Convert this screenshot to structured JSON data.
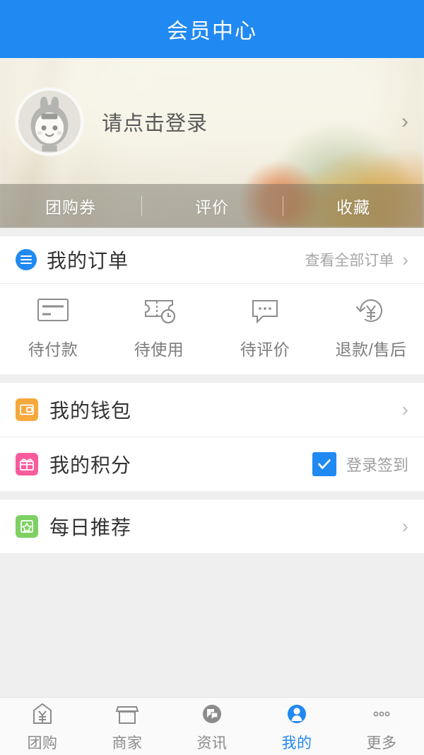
{
  "header": {
    "title": "会员中心",
    "bg_color": "#2089f2"
  },
  "profile": {
    "login_text": "请点击登录",
    "avatar_icon": "default-rabbit-avatar",
    "arrow_icon": "chevron-right-icon"
  },
  "stats": [
    {
      "label": "团购券"
    },
    {
      "label": "评价"
    },
    {
      "label": "收藏"
    }
  ],
  "orders": {
    "title": "我的订单",
    "icon": "list-circle-icon",
    "view_all": "查看全部订单",
    "chevron_icon": "chevron-right-icon",
    "items": [
      {
        "label": "待付款",
        "icon": "credit-card-icon"
      },
      {
        "label": "待使用",
        "icon": "ticket-clock-icon"
      },
      {
        "label": "待评价",
        "icon": "comment-bubble-icon"
      },
      {
        "label": "退款/售后",
        "icon": "refund-yen-icon"
      }
    ]
  },
  "menu": {
    "wallet": {
      "label": "我的钱包",
      "icon": "wallet-icon",
      "color": "#f5a93c",
      "chevron_icon": "chevron-right-icon"
    },
    "points": {
      "label": "我的积分",
      "icon": "gift-icon",
      "color": "#f95b9b",
      "checkin_label": "登录签到",
      "checkin_checked": true,
      "checkbox_color": "#2089f2",
      "check_icon": "check-icon"
    },
    "daily": {
      "label": "每日推荐",
      "icon": "star-frame-icon",
      "color": "#7ed063",
      "chevron_icon": "chevron-right-icon"
    }
  },
  "tabbar": {
    "active_color": "#2089f2",
    "items": [
      {
        "label": "团购",
        "icon": "tag-yen-icon",
        "active": false
      },
      {
        "label": "商家",
        "icon": "shop-icon",
        "active": false
      },
      {
        "label": "资讯",
        "icon": "chat-circle-icon",
        "active": false
      },
      {
        "label": "我的",
        "icon": "person-circle-icon",
        "active": true
      },
      {
        "label": "更多",
        "icon": "dots-icon",
        "active": false
      }
    ]
  }
}
